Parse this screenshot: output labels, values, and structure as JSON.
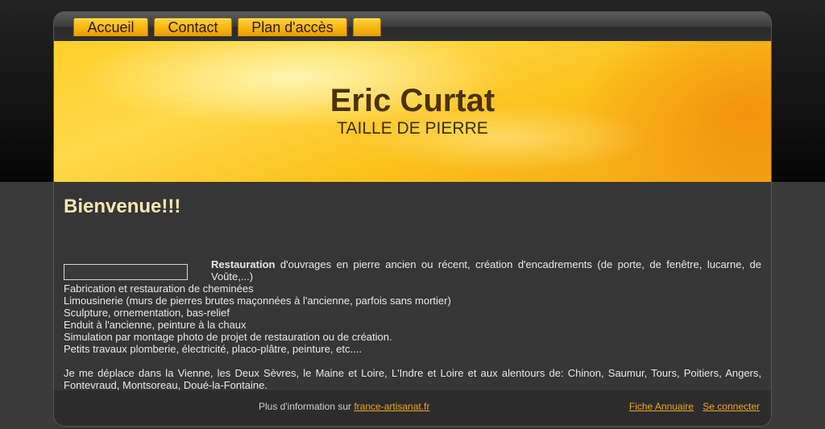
{
  "nav": {
    "tabs": [
      {
        "label": "Accueil"
      },
      {
        "label": "Contact"
      },
      {
        "label": "Plan d'accès"
      },
      {
        "label": ""
      }
    ]
  },
  "banner": {
    "title": "Eric Curtat",
    "subtitle": "TAILLE DE PIERRE"
  },
  "main": {
    "heading": "Bienvenue!!!",
    "intro_bold": "Restauration",
    "intro_rest": " d'ouvrages en pierre ancien ou récent, création d'encadrements (de porte, de fenêtre, lucarne, de Voûte,...)",
    "lines": [
      "Fabrication et restauration de cheminées",
      "Limousinerie (murs de pierres brutes maçonnées à l'ancienne, parfois sans mortier)",
      "Sculpture, ornementation, bas-relief",
      "Enduit à l'ancienne, peinture à la chaux",
      "Simulation par montage photo de projet de restauration ou de création.",
      "Petits travaux plomberie, électricité, placo-plâtre, peinture, etc...."
    ],
    "area_text": "Je me déplace dans la Vienne, les Deux Sèvres, le Maine et Loire, L'Indre et Loire et aux alentours de: Chinon, Saumur, Tours, Poitiers, Angers, Fontevraud, Montsoreau, Doué-la-Fontaine."
  },
  "footer": {
    "info_text": "Plus d'information sur ",
    "info_link": "france-artisanat.fr",
    "fiche_link": "Fiche Annuaire",
    "login_link": "Se connecter"
  },
  "colors": {
    "accent": "#f7b20c",
    "link": "#f3a51b",
    "heading": "#f6e7b2"
  }
}
